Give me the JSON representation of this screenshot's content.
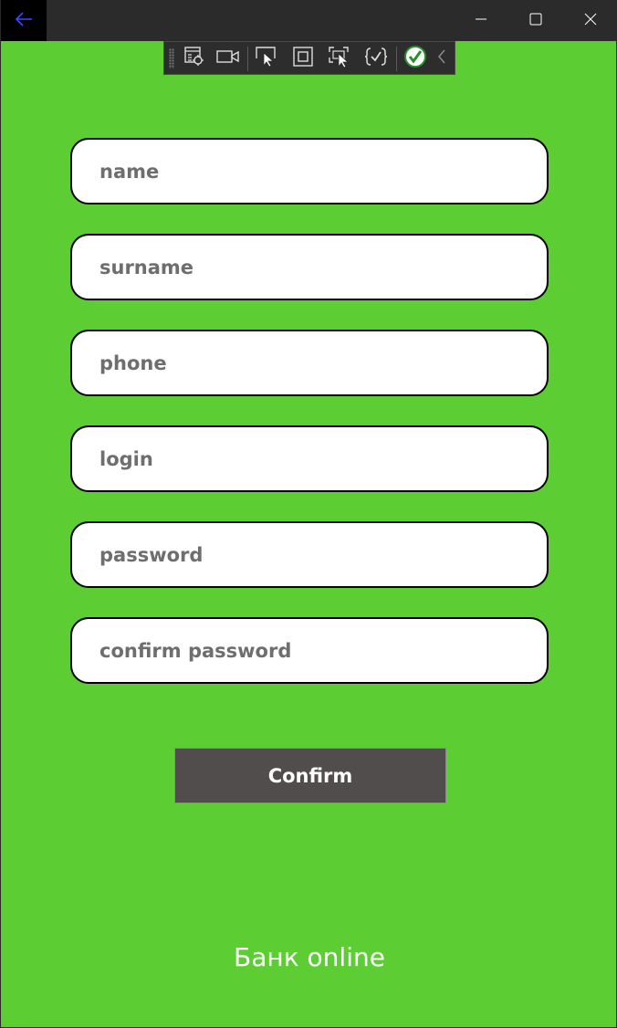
{
  "titlebar": {
    "back_icon": "back-arrow-icon",
    "minimize_icon": "minimize-icon",
    "maximize_icon": "maximize-icon",
    "close_icon": "close-icon",
    "back_arrow_color": "#3a47ff"
  },
  "devtools_toolbar": {
    "tools": [
      "live-visual-tree-icon",
      "record-video-icon",
      "select-element-icon",
      "display-layout-adorners-icon",
      "track-focus-icon",
      "binding-failures-icon",
      "hot-reload-ok-icon",
      "collapse-chevron-icon"
    ]
  },
  "form": {
    "fields": [
      {
        "placeholder": "name",
        "value": ""
      },
      {
        "placeholder": "surname",
        "value": ""
      },
      {
        "placeholder": "phone",
        "value": ""
      },
      {
        "placeholder": "login",
        "value": ""
      },
      {
        "placeholder": "password",
        "value": ""
      },
      {
        "placeholder": "confirm password",
        "value": ""
      }
    ],
    "confirm_label": "Confirm"
  },
  "footer": {
    "title": "Банк online"
  },
  "colors": {
    "background": "#5dcd34",
    "button": "#524d4d",
    "field_border": "#000000",
    "placeholder": "#6e6e6e"
  }
}
